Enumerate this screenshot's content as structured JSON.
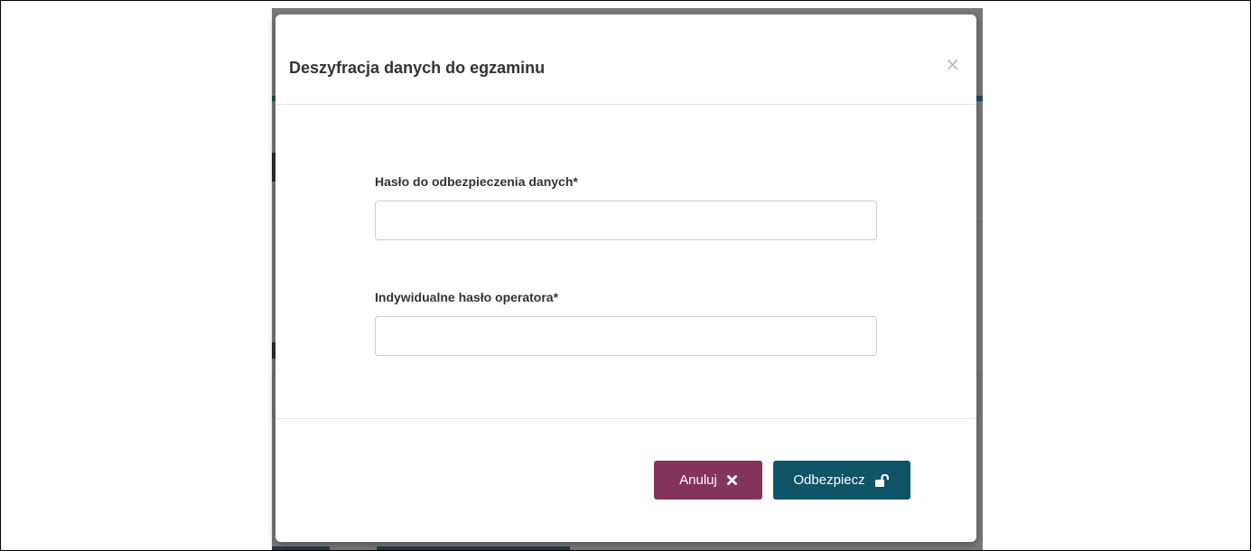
{
  "modal": {
    "title": "Deszyfracja danych do egzaminu",
    "close_symbol": "×"
  },
  "form": {
    "data_password": {
      "label": "Hasło do odbezpieczenia danych*",
      "value": "",
      "placeholder": ""
    },
    "operator_password": {
      "label": "Indywidualne hasło operatora*",
      "value": "",
      "placeholder": ""
    }
  },
  "buttons": {
    "cancel": {
      "label": "Anuluj",
      "icon": "times-icon",
      "color": "#84335a"
    },
    "unlock": {
      "label": "Odbezpiecz",
      "icon": "unlock-icon",
      "color": "#0f5467"
    }
  }
}
